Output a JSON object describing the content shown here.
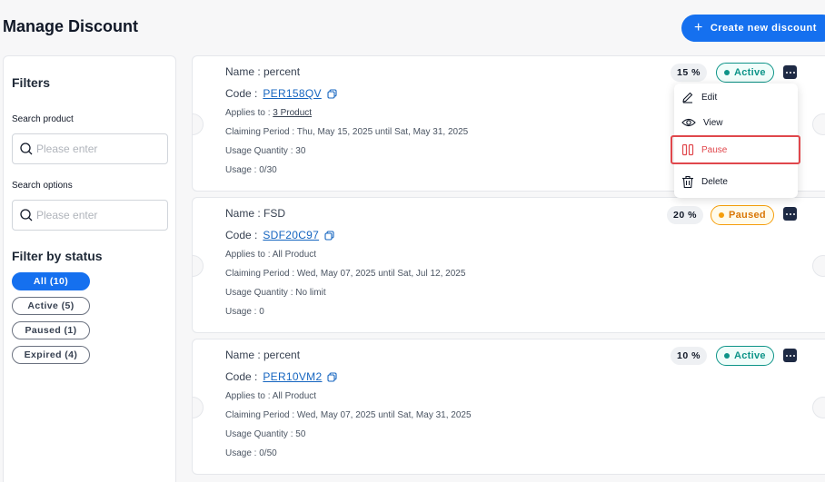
{
  "header": {
    "title": "Manage Discount",
    "create_button": "Create new discount"
  },
  "filters": {
    "title": "Filters",
    "search_product_label": "Search product",
    "search_product_placeholder": "Please enter",
    "search_options_label": "Search options",
    "search_options_placeholder": "Please enter",
    "status_title": "Filter by status",
    "statuses": [
      {
        "label": "All (10)",
        "selected": true
      },
      {
        "label": "Active (5)",
        "selected": false
      },
      {
        "label": "Paused (1)",
        "selected": false
      },
      {
        "label": "Expired (4)",
        "selected": false
      }
    ]
  },
  "discounts": [
    {
      "name": "Name : percent",
      "code_label": "Code :",
      "code": "PER158QV",
      "applies_label": "Applies to : ",
      "applies_value": "3 Product",
      "claiming": "Claiming Period : Thu, May 15, 2025 until Sat, May 31, 2025",
      "quantity": "Usage Quantity : 30",
      "usage": "Usage : 0/30",
      "percent": "15 %",
      "status": "Active"
    },
    {
      "name": "Name : FSD",
      "code_label": "Code :",
      "code": "SDF20C97",
      "applies_label": "Applies to : All Product",
      "applies_value": "",
      "claiming": "Claiming Period : Wed, May 07, 2025 until Sat, Jul 12, 2025",
      "quantity": "Usage Quantity : No limit",
      "usage": "Usage : 0",
      "percent": "20 %",
      "status": "Paused"
    },
    {
      "name": "Name : percent",
      "code_label": "Code :",
      "code": "PER10VM2",
      "applies_label": "Applies to : All Product",
      "applies_value": "",
      "claiming": "Claiming Period : Wed, May 07, 2025 until Sat, May 31, 2025",
      "quantity": "Usage Quantity : 50",
      "usage": "Usage : 0/50",
      "percent": "10 %",
      "status": "Active"
    }
  ],
  "menu": {
    "items": [
      "Edit",
      "View",
      "Pause",
      "Delete"
    ]
  },
  "colors": {
    "primary": "#1570ef",
    "active": "#0d9488",
    "paused": "#f59e0b",
    "danger": "#e0474c"
  }
}
